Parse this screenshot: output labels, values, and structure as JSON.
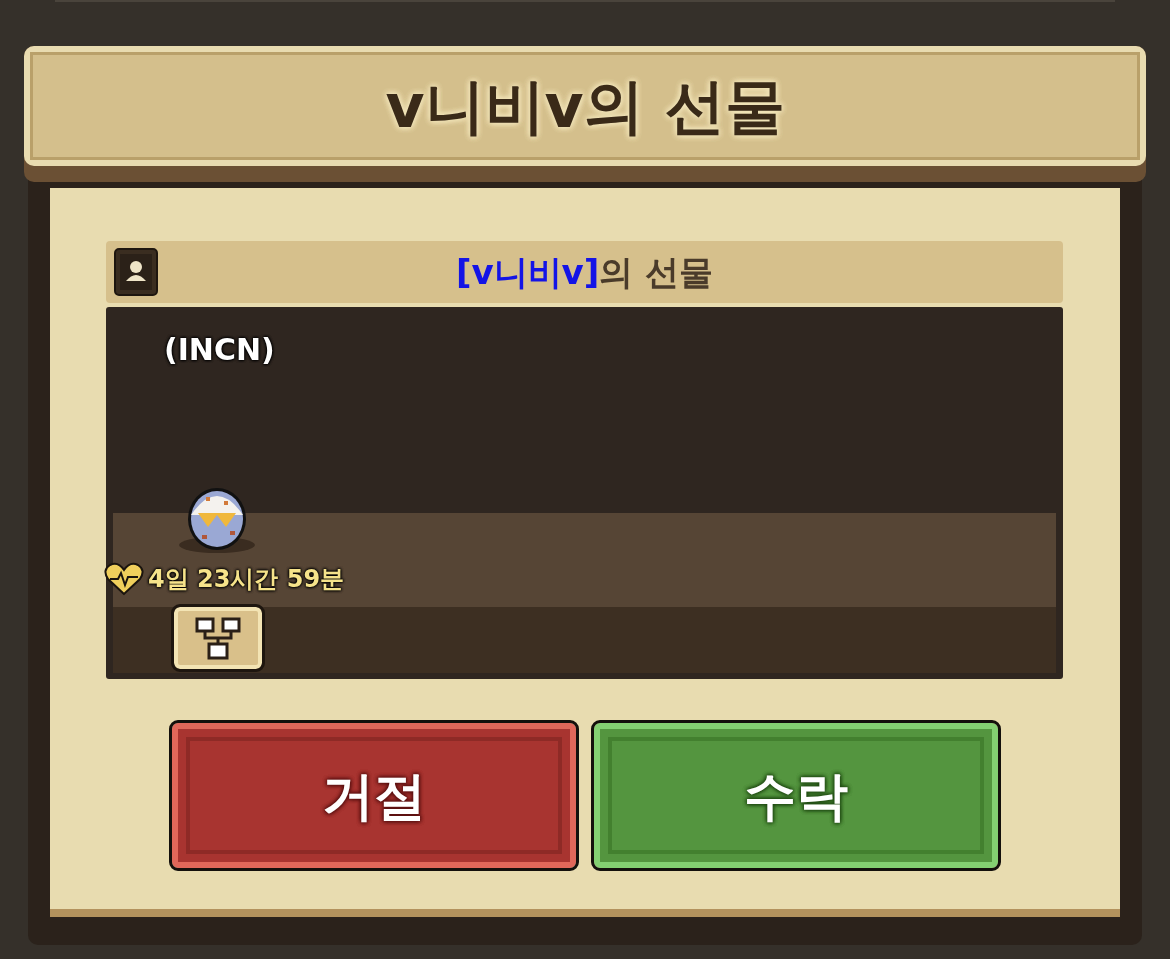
{
  "dialog": {
    "title": "v니비v의 선물",
    "gift_header": {
      "sender": "[v니비v]",
      "suffix": "의 선물"
    },
    "pet": {
      "name": "(INCN)",
      "timer": "4일 23시간 59분"
    },
    "buttons": [
      {
        "label": "거절",
        "kind": "reject"
      },
      {
        "label": "수락",
        "kind": "accept"
      }
    ]
  }
}
